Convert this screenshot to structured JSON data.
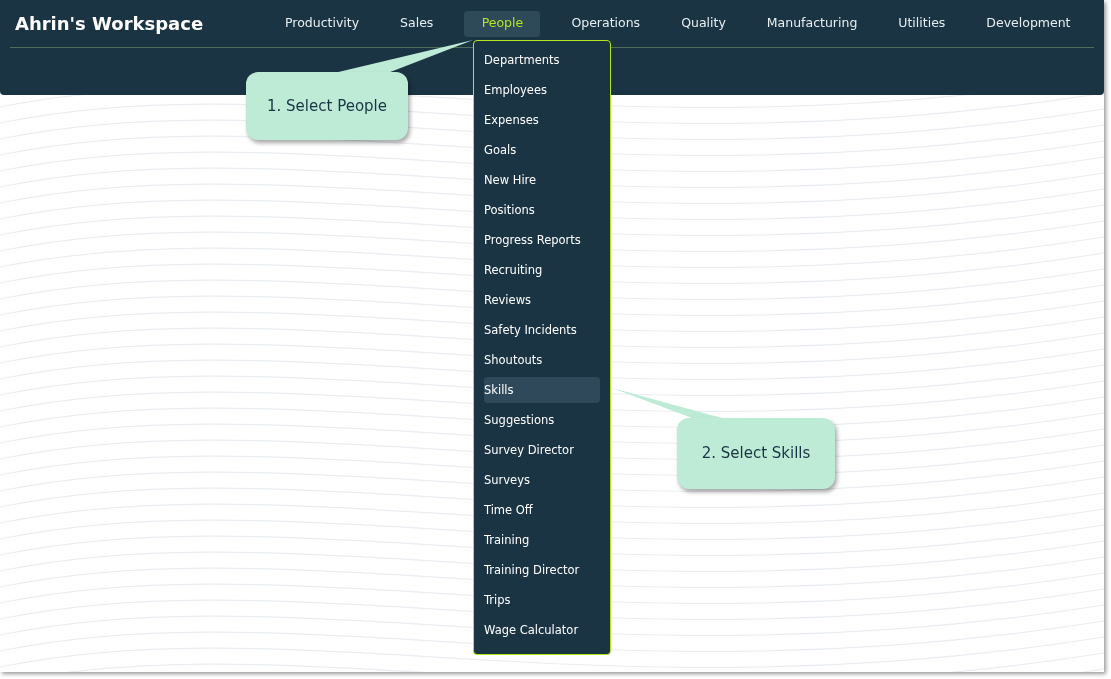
{
  "workspace_title": "Ahrin's Workspace",
  "nav": [
    {
      "label": "Productivity",
      "selected": false
    },
    {
      "label": "Sales",
      "selected": false
    },
    {
      "label": "People",
      "selected": true
    },
    {
      "label": "Operations",
      "selected": false
    },
    {
      "label": "Quality",
      "selected": false
    },
    {
      "label": "Manufacturing",
      "selected": false
    },
    {
      "label": "Utilities",
      "selected": false
    },
    {
      "label": "Development",
      "selected": false
    }
  ],
  "menu": {
    "items": [
      {
        "label": "Departments",
        "selected": false
      },
      {
        "label": "Employees",
        "selected": false
      },
      {
        "label": "Expenses",
        "selected": false
      },
      {
        "label": "Goals",
        "selected": false
      },
      {
        "label": "New Hire",
        "selected": false
      },
      {
        "label": "Positions",
        "selected": false
      },
      {
        "label": "Progress Reports",
        "selected": false
      },
      {
        "label": "Recruiting",
        "selected": false
      },
      {
        "label": "Reviews",
        "selected": false
      },
      {
        "label": "Safety Incidents",
        "selected": false
      },
      {
        "label": "Shoutouts",
        "selected": false
      },
      {
        "label": "Skills",
        "selected": true
      },
      {
        "label": "Suggestions",
        "selected": false
      },
      {
        "label": "Survey Director",
        "selected": false
      },
      {
        "label": "Surveys",
        "selected": false
      },
      {
        "label": "Time Off",
        "selected": false
      },
      {
        "label": "Training",
        "selected": false
      },
      {
        "label": "Training Director",
        "selected": false
      },
      {
        "label": "Trips",
        "selected": false
      },
      {
        "label": "Wage Calculator",
        "selected": false
      }
    ]
  },
  "callouts": [
    {
      "text": "1. Select People"
    },
    {
      "text": "2. Select Skills"
    }
  ]
}
